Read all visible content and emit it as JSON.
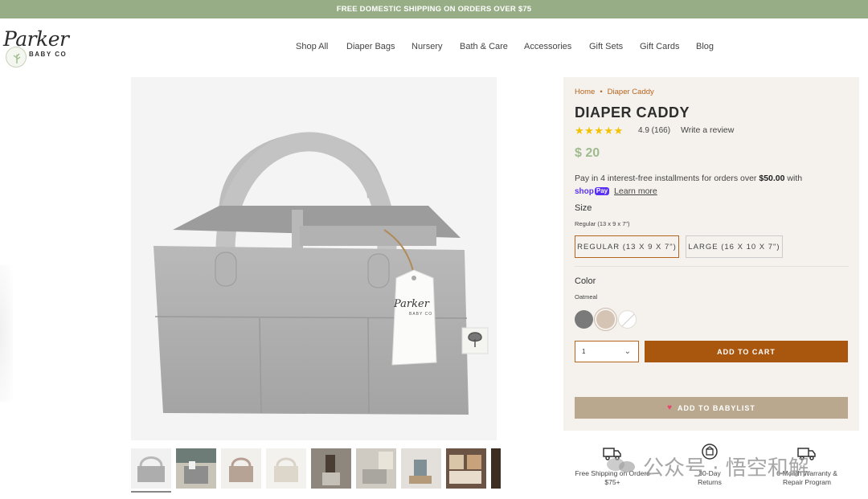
{
  "announcement": "FREE DOMESTIC SHIPPING ON ORDERS OVER $75",
  "logo": {
    "name": "Parker",
    "sub": "BABY CO"
  },
  "nav": [
    "Shop All",
    "Diaper Bags",
    "Nursery",
    "Bath & Care",
    "Accessories",
    "Gift Sets",
    "Gift Cards",
    "Blog"
  ],
  "product": {
    "breadcrumb": [
      "Home",
      "Diaper Caddy"
    ],
    "title": "DIAPER CADDY",
    "stars": "★★★★★",
    "rating": "4.9 (166)",
    "write_review": "Write a review",
    "price": "$ 20",
    "installments_text": "Pay in 4 interest-free installments for orders over ",
    "installments_amount": "$50.00",
    "installments_tail": " with",
    "shoppay_label": "shop",
    "shoppay_badge": "Pay",
    "learn_more": "Learn more",
    "size_label": "Size",
    "size_selected": "Regular (13 x 9 x 7\")",
    "sizes": [
      "REGULAR (13 X 9 X 7\")",
      "LARGE (16 X 10 X 7\")"
    ],
    "color_label": "Color",
    "color_selected": "Oatmeal",
    "swatches": [
      {
        "name": "gray",
        "color": "#7a7a7a"
      },
      {
        "name": "oatmeal",
        "color": "#d5c3b4"
      },
      {
        "name": "white",
        "color": "#ffffff"
      }
    ],
    "quantity": "1",
    "add_to_cart": "ADD TO CART",
    "babylist": "ADD TO BABYLIST",
    "bag_tag_text": "Parker",
    "bag_tag_sub": "BABY CO"
  },
  "features": [
    {
      "icon": "truck-icon",
      "text1": "Free Shipping on Orders",
      "text2": "$75+"
    },
    {
      "icon": "return-box-icon",
      "text1": "30-Day",
      "text2": "Returns"
    },
    {
      "icon": "warranty-truck-icon",
      "text1": "6-Month Warranty &",
      "text2": "Repair Program"
    }
  ],
  "watermark": "公众号 · 悟空和解",
  "colors": {
    "accent": "#a9560e",
    "announce_bg": "#97ad86",
    "price": "#9fbb8e",
    "panel_bg": "#f5f2ee",
    "babylist": "#b9a88d"
  }
}
